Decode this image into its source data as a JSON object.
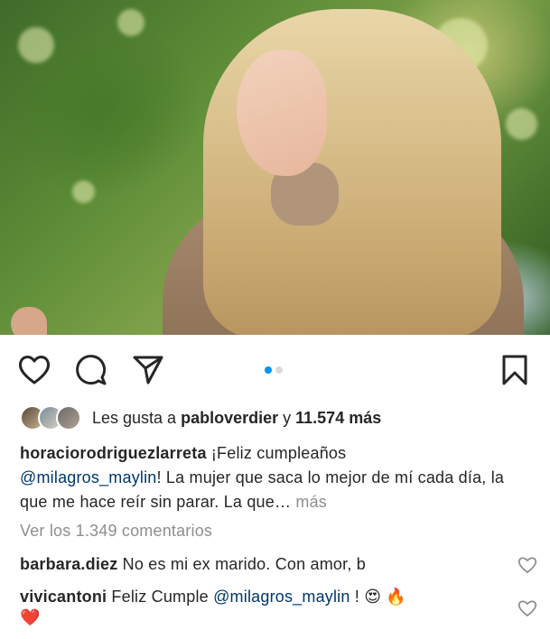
{
  "post": {
    "photo_icon": "portrait-photo",
    "carousel": {
      "total": 2,
      "active": 1,
      "active_color": "#0095f6",
      "inactive_color": "#dbdbdb"
    }
  },
  "actions": {
    "like_icon": "heart-icon",
    "comment_icon": "comment-icon",
    "share_icon": "send-icon",
    "save_icon": "bookmark-icon"
  },
  "likes": {
    "prefix": "Les gusta a ",
    "user": "pabloverdier",
    "connector": " y ",
    "count": "11.574 más"
  },
  "caption": {
    "author": "horaciorodriguezlarreta",
    "text_1": " ¡Feliz cumpleaños ",
    "mention": "@milagros_maylin",
    "text_2": "! La mujer que saca lo mejor de mí cada día, la que me hace reír sin parar. La que…",
    "more": " más"
  },
  "view_comments": "Ver los 1.349 comentarios",
  "comments": [
    {
      "user": "barbara.diez",
      "text": " No es mi ex marido. Con amor, b"
    },
    {
      "user": "vivicantoni",
      "text_1": " Feliz Cumple ",
      "mention": "@milagros_maylin",
      "text_2": " ! ",
      "emoji_1": "😍",
      "emoji_2": "🔥",
      "emoji_3": "❤️"
    }
  ],
  "colors": {
    "mention": "#00376b",
    "muted": "#8e8e8e",
    "text": "#262626"
  }
}
